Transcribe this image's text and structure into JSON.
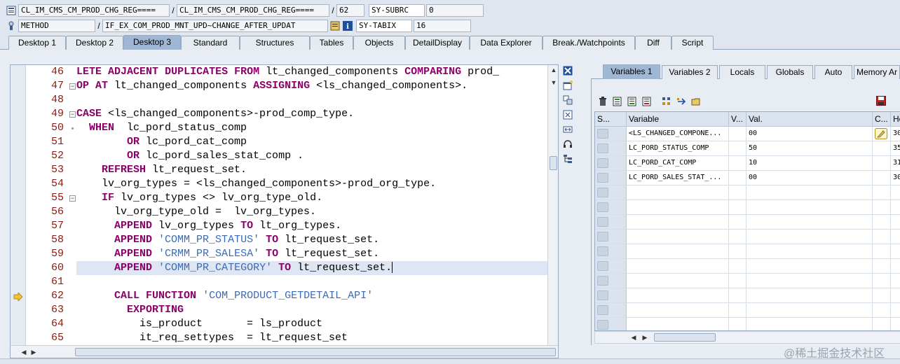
{
  "info": {
    "row1": {
      "field1": "CL_IM_CMS_CM_PROD_CHG_REG====",
      "sep1": "/",
      "field2": "CL_IM_CMS_CM_PROD_CHG_REG====",
      "sep2": "/",
      "field3": "62",
      "sysname": "SY-SUBRC",
      "sysval": "0"
    },
    "row2": {
      "field1": "METHOD",
      "sep1": "/",
      "field2": "IF_EX_COM_PROD_MNT_UPD~CHANGE_AFTER_UPDAT",
      "sysname": "SY-TABIX",
      "sysval": "16"
    }
  },
  "tabs": [
    "Desktop 1",
    "Desktop 2",
    "Desktop 3",
    "Standard",
    "Structures",
    "Tables",
    "Objects",
    "DetailDisplay",
    "Data Explorer",
    "Break./Watchpoints",
    "Diff",
    "Script"
  ],
  "editor": {
    "lines": [
      {
        "num": "46",
        "text": "LETE ADJACENT DUPLICATES FROM lt_changed_components COMPARING prod_"
      },
      {
        "num": "47",
        "text": "OP AT lt_changed_components ASSIGNING <ls_changed_components>."
      },
      {
        "num": "48",
        "text": ""
      },
      {
        "num": "49",
        "text": "CASE <ls_changed_components>-prod_comp_type."
      },
      {
        "num": "50",
        "text": "  WHEN  lc_pord_status_comp"
      },
      {
        "num": "51",
        "text": "        OR lc_pord_cat_comp"
      },
      {
        "num": "52",
        "text": "        OR lc_pord_sales_stat_comp ."
      },
      {
        "num": "53",
        "text": "    REFRESH lt_request_set."
      },
      {
        "num": "54",
        "text": "    lv_org_types = <ls_changed_components>-prod_org_type."
      },
      {
        "num": "55",
        "text": "    IF lv_org_types <> lv_org_type_old."
      },
      {
        "num": "56",
        "text": "      lv_org_type_old =  lv_org_types."
      },
      {
        "num": "57",
        "text": "      APPEND lv_org_types TO lt_org_types."
      },
      {
        "num": "58",
        "text": "      APPEND 'COMM_PR_STATUS' TO lt_request_set."
      },
      {
        "num": "59",
        "text": "      APPEND 'CRMM_PR_SALESA' TO lt_request_set."
      },
      {
        "num": "60",
        "text": "      APPEND 'COMM_PR_CATEGORY' TO lt_request_set."
      },
      {
        "num": "61",
        "text": ""
      },
      {
        "num": "62",
        "text": "      CALL FUNCTION 'COM_PRODUCT_GETDETAIL_API'"
      },
      {
        "num": "63",
        "text": "        EXPORTING"
      },
      {
        "num": "64",
        "text": "          is_product       = ls_product"
      },
      {
        "num": "65",
        "text": "          it_req_settypes  = lt_request_set"
      }
    ]
  },
  "variables": {
    "tabs": [
      "Variables 1",
      "Variables 2",
      "Locals",
      "Globals",
      "Auto",
      "Memory Ar"
    ],
    "headers": [
      "S...",
      "Variable",
      "V...",
      "Val.",
      "C...",
      "He"
    ],
    "rows": [
      {
        "variable": "<LS_CHANGED_COMPONE...",
        "value": "00",
        "hex": "30"
      },
      {
        "variable": "LC_PORD_STATUS_COMP",
        "value": "50",
        "hex": "35"
      },
      {
        "variable": "LC_PORD_CAT_COMP",
        "value": "10",
        "hex": "31"
      },
      {
        "variable": "LC_PORD_SALES_STAT_...",
        "value": "00",
        "hex": "30"
      }
    ]
  },
  "watermark": "@稀土掘金技术社区"
}
